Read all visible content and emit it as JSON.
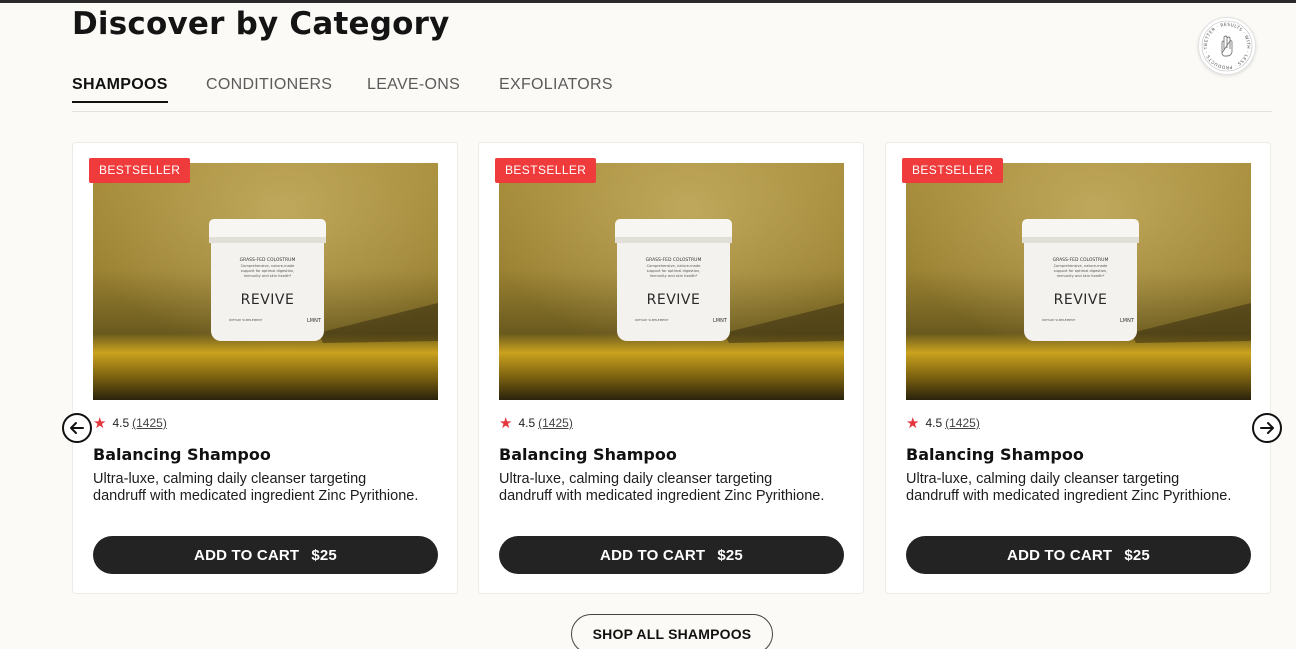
{
  "section": {
    "title": "Discover by Category"
  },
  "tabs": [
    {
      "label": "SHAMPOOS",
      "active": true
    },
    {
      "label": "CONDITIONERS",
      "active": false
    },
    {
      "label": "LEAVE-ONS",
      "active": false
    },
    {
      "label": "EXFOLIATORS",
      "active": false
    }
  ],
  "products": [
    {
      "badge": "BESTSELLER",
      "rating": "4.5",
      "review_count": "(1425)",
      "name": "Balancing Shampoo",
      "description": "Ultra-luxe, calming daily cleanser targeting dandruff with medicated ingredient Zinc Pyrithione.",
      "cart_label": "ADD TO CART",
      "price": "$25",
      "jar_brand": "REVIVE",
      "jar_label_line1": "GRASS-FED COLOSTRUM",
      "jar_label_line2": "Comprehensive, nature-made",
      "jar_label_line3": "support for optimal digestion,",
      "jar_label_line4": "immunity and skin health*",
      "jar_footer_left": "DIETARY SUPPLEMENT",
      "jar_footer_right": "LMNT"
    },
    {
      "badge": "BESTSELLER",
      "rating": "4.5",
      "review_count": "(1425)",
      "name": "Balancing Shampoo",
      "description": "Ultra-luxe, calming daily cleanser targeting dandruff with medicated ingredient Zinc Pyrithione.",
      "cart_label": "ADD TO CART",
      "price": "$25",
      "jar_brand": "REVIVE",
      "jar_label_line1": "GRASS-FED COLOSTRUM",
      "jar_label_line2": "Comprehensive, nature-made",
      "jar_label_line3": "support for optimal digestion,",
      "jar_label_line4": "immunity and skin health*",
      "jar_footer_left": "DIETARY SUPPLEMENT",
      "jar_footer_right": "LMNT"
    },
    {
      "badge": "BESTSELLER",
      "rating": "4.5",
      "review_count": "(1425)",
      "name": "Balancing Shampoo",
      "description": "Ultra-luxe, calming daily cleanser targeting dandruff with medicated ingredient Zinc Pyrithione.",
      "cart_label": "ADD TO CART",
      "price": "$25",
      "jar_brand": "REVIVE",
      "jar_label_line1": "GRASS-FED COLOSTRUM",
      "jar_label_line2": "Comprehensive, nature-made",
      "jar_label_line3": "support for optimal digestion,",
      "jar_label_line4": "immunity and skin health*",
      "jar_footer_left": "DIETARY SUPPLEMENT",
      "jar_footer_right": "LMNT"
    }
  ],
  "carousel": {
    "prev_icon": "arrow-left-icon",
    "next_icon": "arrow-right-icon"
  },
  "shop_all": {
    "label": "SHOP ALL SHAMPOOS"
  },
  "seal": {
    "icon": "hand-seal-icon",
    "text": "BETTER · RESULTS · WITH · LESS · PRODUCTS · TIME"
  },
  "colors": {
    "badge": "#ef3b3b",
    "button": "#232323",
    "star": "#e4343c",
    "background": "#fbfaf6"
  }
}
